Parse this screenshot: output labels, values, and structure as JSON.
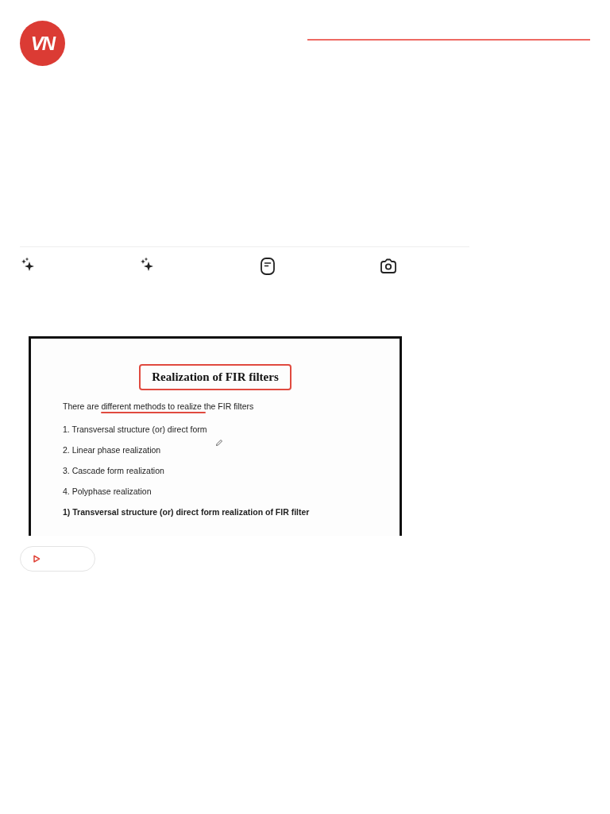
{
  "logo": {
    "text": "VN"
  },
  "actions": [
    {
      "kind": "sparkle"
    },
    {
      "kind": "sparkle"
    },
    {
      "kind": "note"
    },
    {
      "kind": "camera"
    }
  ],
  "video": {
    "document": {
      "title": "Realization of FIR filters",
      "intro": "There are different methods to realize the FIR filters",
      "items": [
        "1. Transversal structure (or) direct form",
        "2. Linear phase realization",
        "3. Cascade form realization",
        "4. Polyphase realization"
      ],
      "heading": "1) Transversal structure (or) direct form realization of FIR filter"
    }
  },
  "play_button": {
    "kind": "play"
  }
}
